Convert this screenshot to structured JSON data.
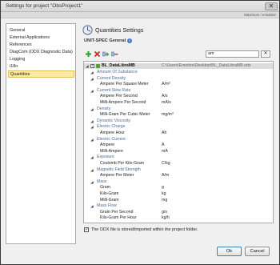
{
  "window": {
    "title": "Settings for project \"ObsProject1\"",
    "close_glyph": "✕",
    "status_text": "Maximum / emulator"
  },
  "sidebar": {
    "items": [
      {
        "label": "General"
      },
      {
        "label": "External Applications"
      },
      {
        "label": "References"
      },
      {
        "label": "DiagCom (ODX Diagnostic Data)"
      },
      {
        "label": "Logging"
      },
      {
        "label": "i18n"
      },
      {
        "label": "Quantities"
      }
    ],
    "selected": "Quantities"
  },
  "main": {
    "title": "Quantities Settings",
    "section": "UNIT-SPEC General",
    "info_glyph": "i",
    "search_value": "am",
    "search_clear_glyph": "✕",
    "toolbar_icons": [
      "add-icon",
      "delete-icon",
      "add-child-icon",
      "remove-child-icon"
    ]
  },
  "tree": {
    "root": {
      "label": "BL_DataLibraMB",
      "path": "C:\\Users\\Emotive\\Desktop\\BL_DataLibraMB.odx",
      "checked_glyph": "✓"
    },
    "rows": [
      {
        "type": "category",
        "label": "Amount Of Substance"
      },
      {
        "type": "category",
        "label": "Current Density"
      },
      {
        "type": "unit",
        "label": "Ampere Per Square Meter",
        "symbol": "A/m²"
      },
      {
        "type": "category",
        "label": "Current Slew Rate"
      },
      {
        "type": "unit",
        "label": "Ampere Per Second",
        "symbol": "A/s"
      },
      {
        "type": "unit",
        "label": "Milli-Ampere Per Second",
        "symbol": "mA/s"
      },
      {
        "type": "category",
        "label": "Density"
      },
      {
        "type": "unit",
        "label": "Milli-Gram Per Cubic Meter",
        "symbol": "mg/m³"
      },
      {
        "type": "category",
        "label": "Dynamic Viscosity"
      },
      {
        "type": "category",
        "label": "Electric Charge"
      },
      {
        "type": "unit",
        "label": "Ampere Hour",
        "symbol": "Ah"
      },
      {
        "type": "category",
        "label": "Electric Current"
      },
      {
        "type": "unit",
        "label": "Ampere",
        "symbol": "A"
      },
      {
        "type": "unit",
        "label": "Milli-Ampere",
        "symbol": "mA"
      },
      {
        "type": "category",
        "label": "Exposure"
      },
      {
        "type": "unit",
        "label": "Coulomb Per Kilo-Gram",
        "symbol": "C/kg"
      },
      {
        "type": "category",
        "label": "Magnetic Field Strength"
      },
      {
        "type": "unit",
        "label": "Ampere Per Meter",
        "symbol": "A/m"
      },
      {
        "type": "category",
        "label": "Mass"
      },
      {
        "type": "unit",
        "label": "Gram",
        "symbol": "g"
      },
      {
        "type": "unit",
        "label": "Kilo-Gram",
        "symbol": "kg"
      },
      {
        "type": "unit",
        "label": "Milli-Gram",
        "symbol": "mg"
      },
      {
        "type": "category",
        "label": "Mass Flow"
      },
      {
        "type": "unit",
        "label": "Gram Per Second",
        "symbol": "g/s"
      },
      {
        "type": "unit",
        "label": "Kilo-Gram Per Hour",
        "symbol": "kg/h"
      }
    ]
  },
  "footer": {
    "checkbox_label": "The ODX file is stored/imported within the project folder.",
    "checkbox_glyph": "✓",
    "ok_label": "Ok",
    "cancel_label": "Cancel"
  },
  "colors": {
    "selection": "#fbe9a6",
    "category_text": "#4a6a9a",
    "window_bg": "#f0f0f0"
  }
}
